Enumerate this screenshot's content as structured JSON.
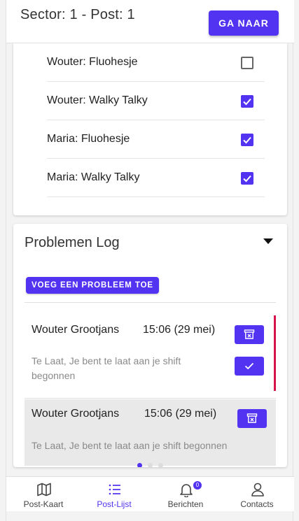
{
  "header": {
    "title": "Sector: 1 - Post: 1",
    "goto_label": "GA NAAR"
  },
  "checklist": {
    "items": [
      {
        "label": "Wouter: Fluohesje",
        "checked": false
      },
      {
        "label": "Wouter: Walky Talky",
        "checked": true
      },
      {
        "label": "Maria: Fluohesje",
        "checked": true
      },
      {
        "label": "Maria: Walky Talky",
        "checked": true
      }
    ]
  },
  "problem_log": {
    "title": "Problemen Log",
    "add_label": "VOEG EEN PROBLEEM TOE",
    "entries": [
      {
        "name": "Wouter Grootjans",
        "time": "15:06 (29 mei)",
        "description": "Te Laat, Je bent te laat aan je shift begonnen",
        "icons": [
          "archive-icon",
          "check-icon"
        ]
      },
      {
        "name": "Wouter Grootjans",
        "time": "15:06 (29 mei)",
        "description": "Te Laat, Je bent te laat aan je shift begonnen",
        "icons": [
          "archive-icon"
        ]
      }
    ],
    "pager": {
      "pages": 3,
      "current": 1
    }
  },
  "bottom_nav": {
    "items": [
      {
        "label": "Post-Kaart",
        "icon": "map-icon",
        "active": false
      },
      {
        "label": "Post-Lijst",
        "icon": "list-icon",
        "active": true
      },
      {
        "label": "Berichten",
        "icon": "bell-icon",
        "active": false,
        "badge": "0"
      },
      {
        "label": "Contacts",
        "icon": "user-icon",
        "active": false
      }
    ]
  },
  "colors": {
    "accent": "#5233f2",
    "alert": "#d8124a"
  }
}
